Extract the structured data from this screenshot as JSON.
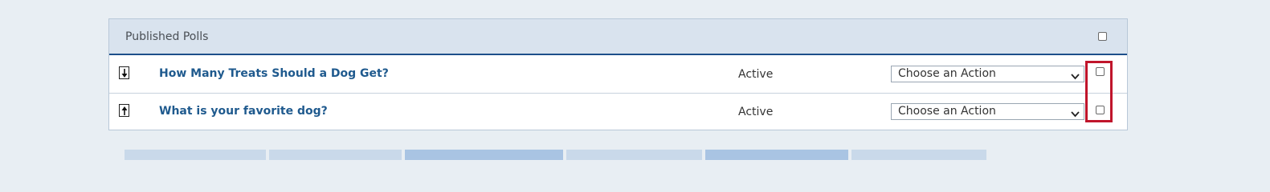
{
  "panel": {
    "title": "Published Polls"
  },
  "polls": [
    {
      "title": "How Many Treats Should a Dog Get?",
      "status": "Active",
      "action_selected": "Choose an Action",
      "sort": "move-down-icon"
    },
    {
      "title": "What is your favorite dog?",
      "status": "Active",
      "action_selected": "Choose an Action",
      "sort": "move-up-icon"
    }
  ],
  "colors": {
    "header_bg": "#d9e3ee",
    "header_border": "#1d4f8a",
    "link": "#1f5a8e",
    "highlight": "#c0152b",
    "tab_light": "#c9d9ea",
    "tab_dark": "#a9c4e3"
  }
}
